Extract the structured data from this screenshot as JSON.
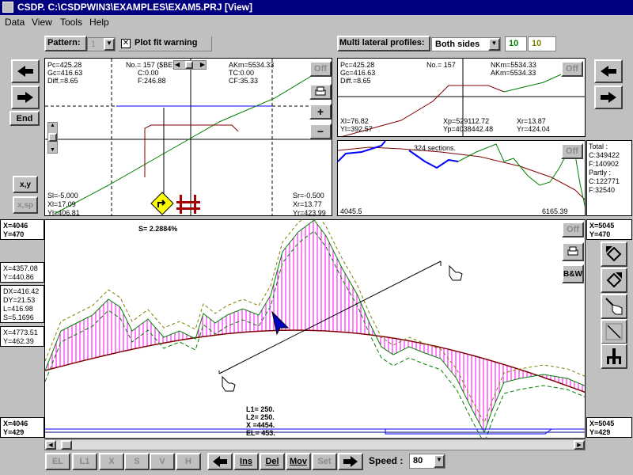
{
  "window": {
    "title": "CSDP. C:\\CSDPWIN3\\EXAMPLES\\EXAM5.PRJ [View]"
  },
  "menu": [
    "Data",
    "View",
    "Tools",
    "Help"
  ],
  "toolbar": {
    "pattern_label": "Pattern:",
    "pattern_value": "1",
    "plot_fit_label": "Plot fit warning",
    "multi_lateral_label": "Multi lateral profiles:",
    "multi_lateral_value": "Both sides",
    "box_a": "10",
    "box_b": "10"
  },
  "left_buttons": {
    "end_label": "End",
    "xy_label": "x,y",
    "xsp_label": "x,sp"
  },
  "top_left_panel": {
    "pc": "Pc=425.28",
    "gc": "Gc=416.63",
    "diff": "Diff.=8.65",
    "no": "No.= 157 ($BE)",
    "c": "C:0.00",
    "f": "F:246.88",
    "akm": "AKm=5534.33",
    "tc": "TC:0.00",
    "cf": "CF:35.33",
    "sl": "Sl=-5.000",
    "xl": "Xl=17.09",
    "yl": "Yl=406.81",
    "sr": "Sr=-0.500",
    "xr": "Xr=13.77",
    "yr": "Yr=423.99"
  },
  "panel_buttons": {
    "off": "Off",
    "plus": "+",
    "minus": "−",
    "bw": "B&W"
  },
  "top_right_panel": {
    "pc": "Pc=425.28",
    "gc": "Gc=416.63",
    "diff": "Diff.=8.65",
    "no": "No.= 157",
    "nkm": "NKm=5534.33",
    "akm": "AKm=5534.33",
    "xl": "Xl=76.82",
    "yl": "Yl=392.57",
    "xp": "Xp=529112.72",
    "yp": "Yp=4038442.48",
    "xr": "Xr=13.87",
    "yr": "Yr=424.04"
  },
  "overview_panel": {
    "sections": "324 sections.",
    "left_value": "4045.5",
    "right_value": "6165.39"
  },
  "totals": {
    "total": "Total :",
    "c": "C:349422",
    "f": "F:140902",
    "partly": "Partly :",
    "pc": "C:122771",
    "pf": "F:32540"
  },
  "coords": {
    "left_top": [
      "X=4046",
      "Y=470"
    ],
    "right_top": [
      "X=5045",
      "Y=470"
    ],
    "left_mid": [
      "X=4357.08",
      "Y=440.86"
    ],
    "left_delta": [
      "DX=416.42",
      "DY=21.53",
      "L=416.98",
      "S=5.1696"
    ],
    "left_low": [
      "X=4773.51",
      "Y=462.39"
    ],
    "left_bottom": [
      "X=4046",
      "Y=429"
    ],
    "right_bottom": [
      "X=5045",
      "Y=429"
    ]
  },
  "main_chart": {
    "slope_label": "S= 2.2884%",
    "l1": "L1= 250.",
    "l2": "L2= 250.",
    "x": "X =4454.",
    "el": "EL= 453."
  },
  "bottom_toolbar": {
    "buttons": [
      "EL",
      "L1",
      "X",
      "S",
      "V",
      "H"
    ],
    "ins": "Ins",
    "del": "Del",
    "mov": "Mov",
    "set": "Set",
    "speed_label": "Speed :",
    "speed_value": "80"
  },
  "colors": {
    "title_bar": "#000080",
    "ground": "#008000",
    "profile": "#800000",
    "fill": "#ff00ff",
    "guide": "#0000ff",
    "box_a_text": "#008000",
    "box_b_text": "#808000"
  }
}
